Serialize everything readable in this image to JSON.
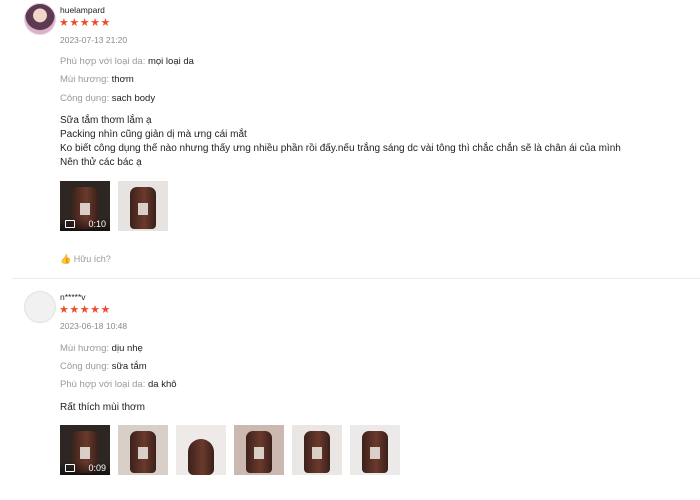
{
  "reviews": [
    {
      "username": "huelampard",
      "stars": "★★★★★",
      "rating": 5,
      "timestamp": "2023-07-13 21:20",
      "attributes": [
        {
          "key": "Phù hợp với loại da:",
          "value": "mọi loại da"
        },
        {
          "key": "Mùi hương:",
          "value": "thơm"
        },
        {
          "key": "Công dụng:",
          "value": "sach body"
        }
      ],
      "body": [
        "Sữa tắm thơm lắm ạ",
        "Packing nhìn cũng giản dị mà ưng cái mắt",
        "Ko biết công dụng thế nào nhưng thấy ưng nhiều phần rồi đấy.nếu trắng sáng dc vài tông thì chắc chắn sẽ là chân ái của mình",
        "Nên thử các bác ạ"
      ],
      "video_duration": "0:10",
      "helpful_label": "Hữu ích?"
    },
    {
      "username": "n*****v",
      "stars": "★★★★★",
      "rating": 5,
      "timestamp": "2023-06-18 10:48",
      "attributes": [
        {
          "key": "Mùi hương:",
          "value": "dịu nhẹ"
        },
        {
          "key": "Công dụng:",
          "value": "sữa tắm"
        },
        {
          "key": "Phù hợp với loại da:",
          "value": "da khô"
        }
      ],
      "body": [
        "Rất thích mùi thơm"
      ],
      "video_duration": "0:09"
    }
  ],
  "colors": {
    "star": "#ee4d2d",
    "muted": "#9a9a9a"
  }
}
